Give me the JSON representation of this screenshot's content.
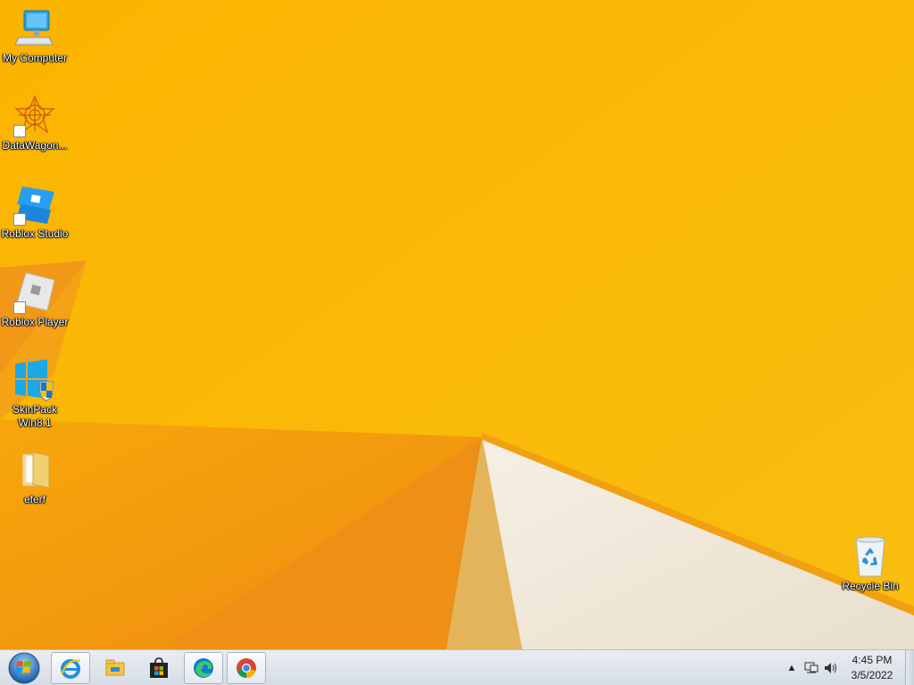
{
  "desktop": {
    "icons": [
      {
        "label": "My Computer",
        "icon": "computer-icon"
      },
      {
        "label": "DataWagon...",
        "icon": "datawagon-icon"
      },
      {
        "label": "Roblox Studio",
        "icon": "roblox-studio-icon"
      },
      {
        "label": "Roblox Player",
        "icon": "roblox-player-icon"
      },
      {
        "label": "SkinPack Win8.1",
        "icon": "skinpack-shield-icon"
      },
      {
        "label": "eferf",
        "icon": "folder-icon"
      },
      {
        "label": "Recycle Bin",
        "icon": "recycle-bin-icon"
      }
    ]
  },
  "taskbar": {
    "start_icon": "windows-orb-icon",
    "pinned": [
      {
        "name": "Internet Explorer",
        "icon": "ie-icon",
        "active": true
      },
      {
        "name": "File Explorer",
        "icon": "file-explorer-icon",
        "active": false
      },
      {
        "name": "Microsoft Store",
        "icon": "store-icon",
        "active": false
      },
      {
        "name": "Microsoft Edge",
        "icon": "edge-icon",
        "active": true
      },
      {
        "name": "Google Chrome",
        "icon": "chrome-icon",
        "active": true
      }
    ],
    "tray": {
      "icons": [
        "show-hidden-icons-icon",
        "network-icon",
        "volume-icon"
      ],
      "time": "4:45 PM",
      "date": "3/5/2022"
    }
  },
  "colors": {
    "wallpaper_primary": "#f9b800",
    "wallpaper_orange": "#f29a10",
    "wallpaper_white": "#f4ede0"
  }
}
